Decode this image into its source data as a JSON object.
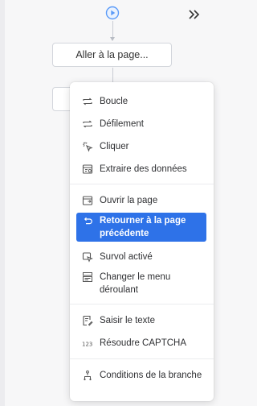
{
  "canvas": {
    "node_label": "Aller à la page..."
  },
  "menu": {
    "groups": [
      [
        {
          "label": "Boucle",
          "icon": "loop-icon"
        },
        {
          "label": "Défilement",
          "icon": "scroll-icon"
        },
        {
          "label": "Cliquer",
          "icon": "click-icon"
        },
        {
          "label": "Extraire des données",
          "icon": "extract-data-icon"
        }
      ],
      [
        {
          "label": "Ouvrir la page",
          "icon": "open-page-icon"
        },
        {
          "label": "Retourner à la page précédente",
          "icon": "back-icon",
          "active": true
        },
        {
          "label": "Survol activé",
          "icon": "hover-icon"
        },
        {
          "label": "Changer le menu déroulant",
          "icon": "dropdown-icon"
        }
      ],
      [
        {
          "label": "Saisir le texte",
          "icon": "input-text-icon"
        },
        {
          "label": "Résoudre CAPTCHA",
          "icon": "captcha-icon"
        }
      ],
      [
        {
          "label": "Conditions de la branche",
          "icon": "branch-icon"
        }
      ]
    ]
  },
  "colors": {
    "accent": "#2e72e8",
    "start_icon": "#5b9bf8"
  }
}
